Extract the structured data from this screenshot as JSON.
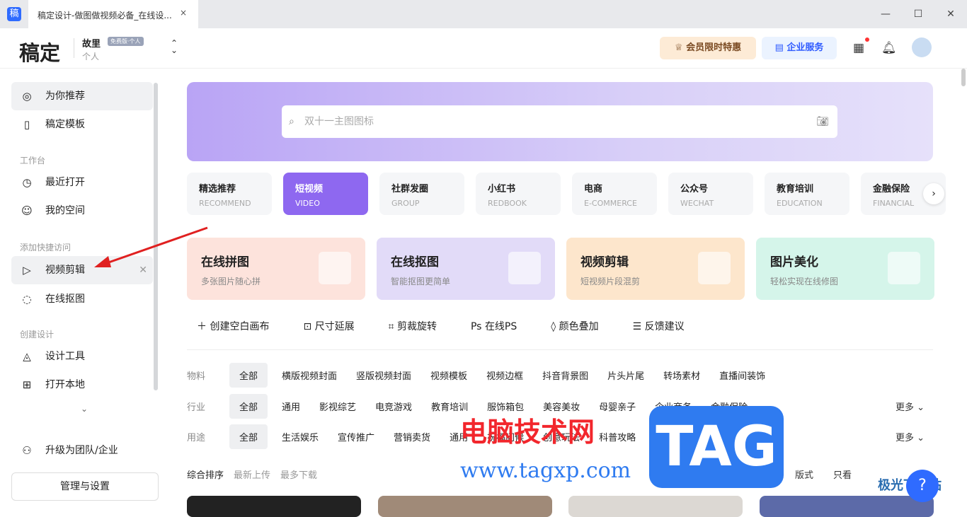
{
  "window": {
    "tab_title": "稿定设计-做图做视频必备_在线设...",
    "app_icon": "稿",
    "close": "×",
    "min": "—",
    "max": "☐",
    "win_close": "✕"
  },
  "header": {
    "logo": "稿定",
    "user": "故里",
    "plan_badge": "免费版·个人",
    "space": "个人",
    "vip": "会员限时特惠",
    "enterprise": "企业服务"
  },
  "sidebar": {
    "items": [
      {
        "label": "为你推荐",
        "icon": "compass-icon"
      },
      {
        "label": "稿定模板",
        "icon": "template-icon"
      }
    ],
    "group_workbench": "工作台",
    "workbench": [
      {
        "label": "最近打开"
      },
      {
        "label": "我的空间"
      }
    ],
    "group_quick": "添加快捷访问",
    "quick": [
      {
        "label": "视频剪辑"
      },
      {
        "label": "在线抠图"
      }
    ],
    "group_create": "创建设计",
    "create": [
      {
        "label": "设计工具"
      },
      {
        "label": "打开本地"
      }
    ],
    "upgrade": "升级为团队/企业",
    "manage": "管理与设置"
  },
  "search": {
    "placeholder": "双十一主图图标"
  },
  "categories": [
    {
      "t": "精选推荐",
      "e": "RECOMMEND"
    },
    {
      "t": "短视频",
      "e": "VIDEO"
    },
    {
      "t": "社群发圈",
      "e": "GROUP"
    },
    {
      "t": "小红书",
      "e": "REDBOOK"
    },
    {
      "t": "电商",
      "e": "E-COMMERCE"
    },
    {
      "t": "公众号",
      "e": "WECHAT"
    },
    {
      "t": "教育培训",
      "e": "EDUCATION"
    },
    {
      "t": "金融保险",
      "e": "FINANCIAL"
    }
  ],
  "tools": [
    {
      "t": "在线拼图",
      "s": "多张图片随心拼",
      "bg": "#fde3dc"
    },
    {
      "t": "在线抠图",
      "s": "智能抠图更简单",
      "bg": "#e2dbf8"
    },
    {
      "t": "视频剪辑",
      "s": "短视频片段混剪",
      "bg": "#fde6cc"
    },
    {
      "t": "图片美化",
      "s": "轻松实现在线修图",
      "bg": "#d5f5ea"
    }
  ],
  "quick_actions": [
    "创建空白画布",
    "尺寸延展",
    "剪裁旋转",
    "在线PS",
    "颜色叠加",
    "反馈建议"
  ],
  "filters": {
    "material": {
      "label": "物料",
      "options": [
        "全部",
        "横版视频封面",
        "竖版视频封面",
        "视频模板",
        "视频边框",
        "抖音背景图",
        "片头片尾",
        "转场素材",
        "直播间装饰"
      ]
    },
    "industry": {
      "label": "行业",
      "options": [
        "全部",
        "通用",
        "影视综艺",
        "电竞游戏",
        "教育培训",
        "服饰箱包",
        "美容美妆",
        "母婴亲子",
        "企业商务",
        "金融保险"
      ],
      "more": "更多"
    },
    "usage": {
      "label": "用途",
      "options": [
        "全部",
        "生活娱乐",
        "宣传推广",
        "营销卖货",
        "通用",
        "祝福问候",
        "创意玩法",
        "科普攻略",
        "企业行政",
        "通知公告"
      ],
      "more": "更多"
    }
  },
  "sort": {
    "options": [
      "综合排序",
      "最新上传",
      "最多下载"
    ],
    "right": [
      "颜色",
      "风格",
      "版式",
      "只看"
    ]
  },
  "help": "?",
  "watermark": {
    "cn": "电脑技术网",
    "url": "www.tagxp.com",
    "tag": "TAG",
    "site": "极光下载站"
  }
}
